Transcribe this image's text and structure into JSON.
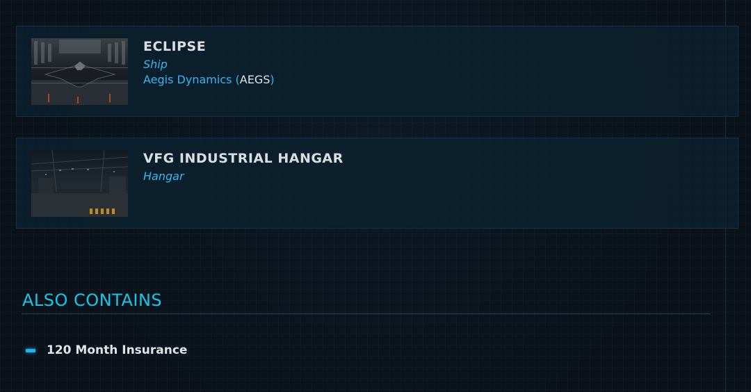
{
  "items": [
    {
      "name": "ECLIPSE",
      "type": "Ship",
      "manufacturer_name": "Aegis Dynamics (",
      "manufacturer_code": "AEGS",
      "manufacturer_close": ")",
      "thumbnail_icon": "spaceship-thumbnail"
    },
    {
      "name": "VFG INDUSTRIAL HANGAR",
      "type": "Hangar",
      "thumbnail_icon": "hangar-thumbnail"
    }
  ],
  "also_contains": {
    "title": "ALSO CONTAINS",
    "items": [
      {
        "label": "120 Month Insurance",
        "icon": "bullet-dash-icon"
      }
    ]
  },
  "colors": {
    "background": "#0a1119",
    "card": "#0c212f",
    "accent": "#13c8ea",
    "link": "#36b7f0",
    "text": "#d9dee2"
  }
}
